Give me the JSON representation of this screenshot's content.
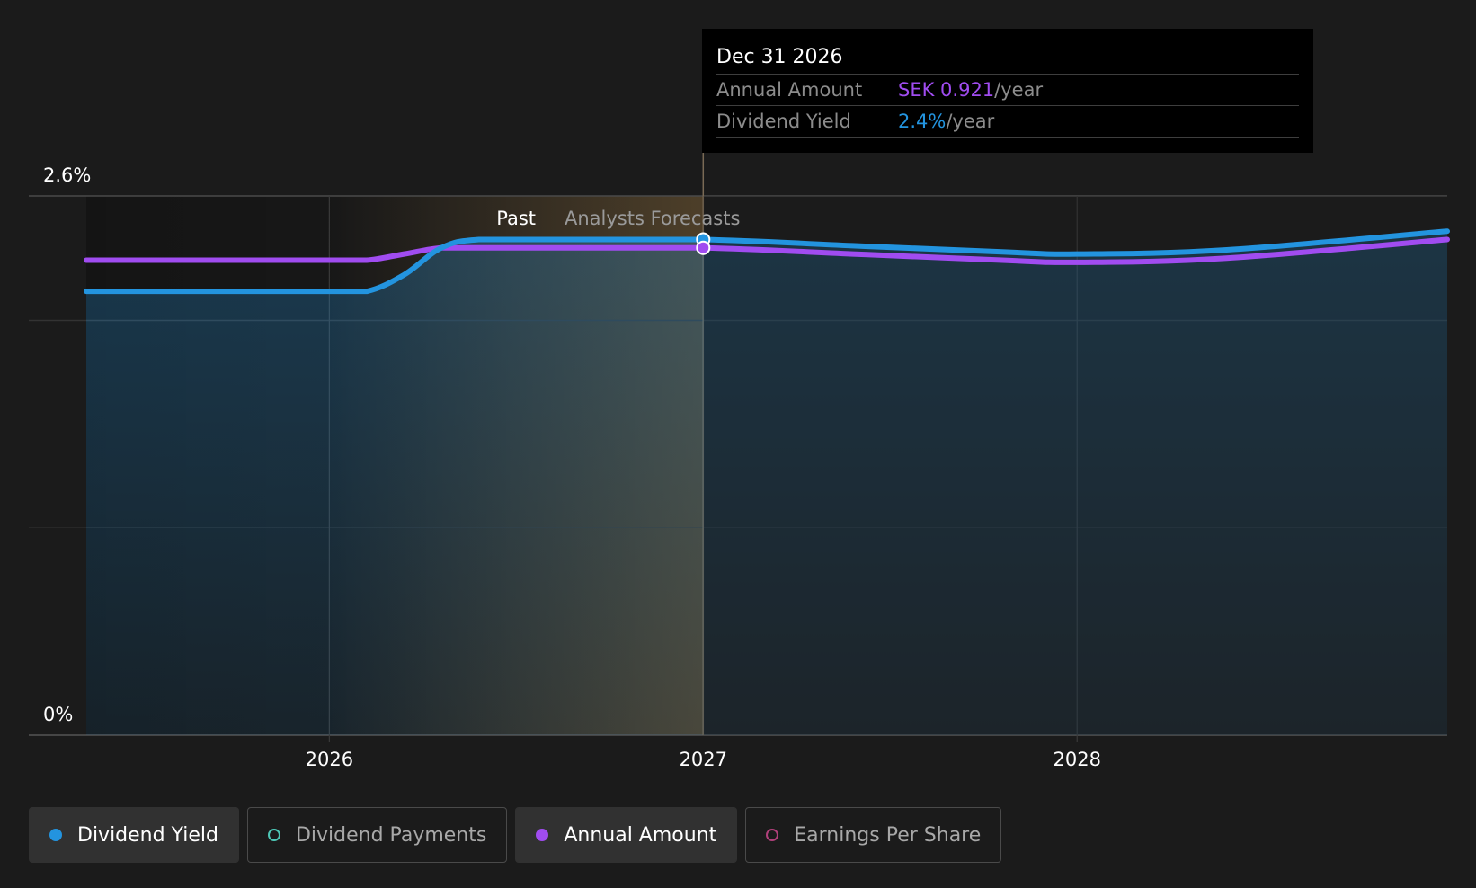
{
  "chart_data": {
    "type": "line",
    "y_axis": {
      "range": [
        0,
        2.6
      ],
      "top_label": "2.6%",
      "bottom_label": "0%"
    },
    "x_axis": {
      "start": 2025.35,
      "end": 2028.99,
      "ticks": [
        {
          "value": 2026,
          "label": "2026"
        },
        {
          "value": 2027,
          "label": "2027"
        },
        {
          "value": 2028,
          "label": "2028"
        }
      ]
    },
    "region_labels": {
      "past": "Past",
      "forecast": "Analysts Forecasts"
    },
    "past_end": 2027.0,
    "series": [
      {
        "name": "Dividend Yield",
        "color": "#2394df",
        "points": [
          [
            2025.35,
            2.14
          ],
          [
            2026.0,
            2.14
          ],
          [
            2026.1,
            2.14
          ],
          [
            2026.2,
            2.22
          ],
          [
            2026.3,
            2.35
          ],
          [
            2026.4,
            2.39
          ],
          [
            2026.6,
            2.39
          ],
          [
            2027.0,
            2.39
          ],
          [
            2027.4,
            2.36
          ],
          [
            2027.8,
            2.33
          ],
          [
            2028.0,
            2.32
          ],
          [
            2028.4,
            2.34
          ],
          [
            2028.99,
            2.43
          ]
        ]
      },
      {
        "name": "Annual Amount",
        "color": "#a04cf0",
        "points": [
          [
            2025.35,
            2.29
          ],
          [
            2026.0,
            2.29
          ],
          [
            2026.1,
            2.29
          ],
          [
            2026.2,
            2.32
          ],
          [
            2026.3,
            2.35
          ],
          [
            2026.4,
            2.35
          ],
          [
            2026.6,
            2.35
          ],
          [
            2027.0,
            2.35
          ],
          [
            2027.4,
            2.32
          ],
          [
            2027.8,
            2.29
          ],
          [
            2028.0,
            2.28
          ],
          [
            2028.4,
            2.3
          ],
          [
            2028.99,
            2.39
          ]
        ]
      }
    ]
  },
  "tooltip": {
    "date": "Dec 31 2026",
    "rows": [
      {
        "label": "Annual Amount",
        "value": "SEK 0.921",
        "unit": "/year",
        "color": "#a04cf0"
      },
      {
        "label": "Dividend Yield",
        "value": "2.4%",
        "unit": "/year",
        "color": "#2394df"
      }
    ]
  },
  "legend": [
    {
      "label": "Dividend Yield",
      "color": "#2394df",
      "active": true
    },
    {
      "label": "Dividend Payments",
      "color": "#4ec7b6",
      "active": false
    },
    {
      "label": "Annual Amount",
      "color": "#a04cf0",
      "active": true
    },
    {
      "label": "Earnings Per Share",
      "color": "#b0407a",
      "active": false
    }
  ]
}
